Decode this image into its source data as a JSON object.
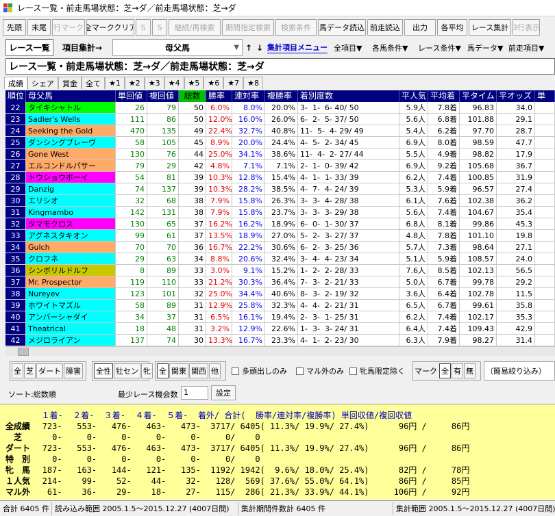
{
  "window": {
    "title": "レース一覧・前走馬場状態：芝→ダ／前走馬場状態：芝→ダ"
  },
  "toolbar": [
    {
      "label": "先頭",
      "w": 34,
      "enabled": true
    },
    {
      "label": "末尾",
      "w": 34,
      "enabled": true
    },
    {
      "label": "行マーク",
      "w": 48,
      "enabled": false
    },
    {
      "label": "全マーククリア",
      "w": 70,
      "enabled": true
    },
    {
      "label": "S",
      "w": 22,
      "enabled": false
    },
    {
      "label": "S",
      "w": 22,
      "enabled": false
    },
    {
      "label": "継続/再検索",
      "w": 76,
      "enabled": false
    },
    {
      "label": "期間指定検索",
      "w": 76,
      "enabled": false
    },
    {
      "label": "検索条件",
      "w": 60,
      "enabled": false
    },
    {
      "label": "馬データ読込",
      "w": 70,
      "enabled": true
    },
    {
      "label": "前走読込",
      "w": 52,
      "enabled": true
    },
    {
      "label": "出力",
      "w": 46,
      "enabled": true
    },
    {
      "label": "各平均",
      "w": 44,
      "enabled": true
    },
    {
      "label": "レース集計",
      "w": 62,
      "enabled": true
    },
    {
      "label": "3行表示",
      "w": 40,
      "enabled": false
    }
  ],
  "toolbar2": {
    "race_list": "レース一覧",
    "item_agg": "項目集計→",
    "combo_value": "母父馬",
    "up_arrow": "↑",
    "down_arrow": "↓",
    "agg_menu": "集計項目メニュー",
    "menus": [
      "全項目▼",
      "各馬条件▼",
      "レース条件▼",
      "馬データ▼",
      "前走項目▼"
    ]
  },
  "headline": "レース一覧・前走馬場状態：芝→ダ／前走馬場状態：芝→ダ",
  "tabs": [
    {
      "label": "成績",
      "active": true
    },
    {
      "label": "シェア",
      "active": false
    },
    {
      "label": "賞金",
      "active": false
    },
    {
      "label": "全て",
      "active": false
    },
    {
      "label": "★1",
      "active": false
    },
    {
      "label": "★2",
      "active": false
    },
    {
      "label": "★3",
      "active": false
    },
    {
      "label": "★4",
      "active": false
    },
    {
      "label": "★5",
      "active": false
    },
    {
      "label": "★6",
      "active": false
    },
    {
      "label": "★7",
      "active": false
    },
    {
      "label": "★8",
      "active": false
    }
  ],
  "colors": {
    "header_bg": "#000080",
    "total_header_bg": "#00c000",
    "rank_bg": "#000080",
    "green": "#00ff00",
    "cyan": "#00ffff",
    "orange": "#ffaa66",
    "magenta": "#ff00ff",
    "olive": "#c8c800",
    "white": "#ffffff",
    "summary_bg": "#ffff99"
  },
  "table": {
    "headers": [
      "順位",
      "母父馬",
      "単回値",
      "複回値",
      "総数",
      "勝率",
      "連対率",
      "複勝率",
      "着別度数",
      "平人気",
      "平均着",
      "平タイム",
      "平オッズ",
      "単"
    ],
    "rows": [
      {
        "rank": "22",
        "name": "タイキシャトル",
        "color": "green",
        "tan": "26",
        "fuku": "79",
        "total": "50",
        "win": "6.0%",
        "ren": "8.0%",
        "fuk": "20.0%",
        "dist": "3-  1-  6- 40/ 50",
        "ninki": "5.9人",
        "chaku": "7.8着",
        "time": "96.83",
        "odds": "34.0"
      },
      {
        "rank": "23",
        "name": "Sadler's Wells",
        "color": "cyan",
        "tan": "111",
        "fuku": "86",
        "total": "50",
        "win": "12.0%",
        "ren": "16.0%",
        "fuk": "26.0%",
        "dist": "6-  2-  5- 37/ 50",
        "ninki": "5.6人",
        "chaku": "6.8着",
        "time": "101.88",
        "odds": "29.1"
      },
      {
        "rank": "24",
        "name": "Seeking the Gold",
        "color": "orange",
        "tan": "470",
        "fuku": "135",
        "total": "49",
        "win": "22.4%",
        "ren": "32.7%",
        "fuk": "40.8%",
        "dist": "11-  5-  4- 29/ 49",
        "ninki": "5.4人",
        "chaku": "6.2着",
        "time": "97.70",
        "odds": "28.7"
      },
      {
        "rank": "25",
        "name": "ダンシングブレーヴ",
        "color": "cyan",
        "tan": "58",
        "fuku": "105",
        "total": "45",
        "win": "8.9%",
        "ren": "20.0%",
        "fuk": "24.4%",
        "dist": "4-  5-  2- 34/ 45",
        "ninki": "6.9人",
        "chaku": "8.0着",
        "time": "98.59",
        "odds": "47.7"
      },
      {
        "rank": "26",
        "name": "Gone West",
        "color": "orange",
        "tan": "130",
        "fuku": "76",
        "total": "44",
        "win": "25.0%",
        "ren": "34.1%",
        "fuk": "38.6%",
        "dist": "11-  4-  2- 27/ 44",
        "ninki": "5.5人",
        "chaku": "4.9着",
        "time": "98.82",
        "odds": "17.9"
      },
      {
        "rank": "27",
        "name": "エルコンドルパサー",
        "color": "orange",
        "tan": "79",
        "fuku": "29",
        "total": "42",
        "win": "4.8%",
        "ren": "7.1%",
        "fuk": "7.1%",
        "dist": "2-  1-  0- 39/ 42",
        "ninki": "6.9人",
        "chaku": "9.2着",
        "time": "105.68",
        "odds": "36.7"
      },
      {
        "rank": "28",
        "name": "トウショウボーイ",
        "color": "magenta",
        "tan": "54",
        "fuku": "81",
        "total": "39",
        "win": "10.3%",
        "ren": "12.8%",
        "fuk": "15.4%",
        "dist": "4-  1-  1- 33/ 39",
        "ninki": "6.2人",
        "chaku": "7.4着",
        "time": "100.85",
        "odds": "31.9"
      },
      {
        "rank": "29",
        "name": "Danzig",
        "color": "cyan",
        "tan": "74",
        "fuku": "137",
        "total": "39",
        "win": "10.3%",
        "ren": "28.2%",
        "fuk": "38.5%",
        "dist": "4-  7-  4- 24/ 39",
        "ninki": "5.3人",
        "chaku": "5.9着",
        "time": "96.57",
        "odds": "27.4"
      },
      {
        "rank": "30",
        "name": "エリシオ",
        "color": "cyan",
        "tan": "32",
        "fuku": "68",
        "total": "38",
        "win": "7.9%",
        "ren": "15.8%",
        "fuk": "26.3%",
        "dist": "3-  3-  4- 28/ 38",
        "ninki": "6.1人",
        "chaku": "7.6着",
        "time": "102.38",
        "odds": "36.2"
      },
      {
        "rank": "31",
        "name": "Kingmambo",
        "color": "cyan",
        "tan": "142",
        "fuku": "131",
        "total": "38",
        "win": "7.9%",
        "ren": "15.8%",
        "fuk": "23.7%",
        "dist": "3-  3-  3- 29/ 38",
        "ninki": "5.6人",
        "chaku": "7.4着",
        "time": "104.67",
        "odds": "35.4"
      },
      {
        "rank": "32",
        "name": "タマモクロス",
        "color": "magenta",
        "tan": "130",
        "fuku": "65",
        "total": "37",
        "win": "16.2%",
        "ren": "16.2%",
        "fuk": "18.9%",
        "dist": "6-  0-  1- 30/ 37",
        "ninki": "6.8人",
        "chaku": "8.1着",
        "time": "99.86",
        "odds": "45.3"
      },
      {
        "rank": "33",
        "name": "アグネスタキオン",
        "color": "cyan",
        "tan": "99",
        "fuku": "61",
        "total": "37",
        "win": "13.5%",
        "ren": "18.9%",
        "fuk": "27.0%",
        "dist": "5-  2-  3- 27/ 37",
        "ninki": "4.8人",
        "chaku": "7.8着",
        "time": "101.10",
        "odds": "19.8"
      },
      {
        "rank": "34",
        "name": "Gulch",
        "color": "orange",
        "tan": "70",
        "fuku": "70",
        "total": "36",
        "win": "16.7%",
        "ren": "22.2%",
        "fuk": "30.6%",
        "dist": "6-  2-  3- 25/ 36",
        "ninki": "5.7人",
        "chaku": "7.3着",
        "time": "98.64",
        "odds": "27.1"
      },
      {
        "rank": "35",
        "name": "クロフネ",
        "color": "cyan",
        "tan": "29",
        "fuku": "63",
        "total": "34",
        "win": "8.8%",
        "ren": "20.6%",
        "fuk": "32.4%",
        "dist": "3-  4-  4- 23/ 34",
        "ninki": "5.1人",
        "chaku": "5.9着",
        "time": "108.57",
        "odds": "24.0"
      },
      {
        "rank": "36",
        "name": "シンボリルドルフ",
        "color": "olive",
        "tan": "8",
        "fuku": "89",
        "total": "33",
        "win": "3.0%",
        "ren": "9.1%",
        "fuk": "15.2%",
        "dist": "1-  2-  2- 28/ 33",
        "ninki": "7.6人",
        "chaku": "8.5着",
        "time": "102.13",
        "odds": "56.5"
      },
      {
        "rank": "37",
        "name": "Mr. Prospector",
        "color": "orange",
        "tan": "119",
        "fuku": "110",
        "total": "33",
        "win": "21.2%",
        "ren": "30.3%",
        "fuk": "36.4%",
        "dist": "7-  3-  2- 21/ 33",
        "ninki": "5.0人",
        "chaku": "6.7着",
        "time": "99.78",
        "odds": "29.2"
      },
      {
        "rank": "38",
        "name": "Nureyev",
        "color": "cyan",
        "tan": "123",
        "fuku": "101",
        "total": "32",
        "win": "25.0%",
        "ren": "34.4%",
        "fuk": "40.6%",
        "dist": "8-  3-  2- 19/ 32",
        "ninki": "3.6人",
        "chaku": "6.4着",
        "time": "102.78",
        "odds": "11.5"
      },
      {
        "rank": "39",
        "name": "ホワイトマズル",
        "color": "cyan",
        "tan": "58",
        "fuku": "89",
        "total": "31",
        "win": "12.9%",
        "ren": "25.8%",
        "fuk": "32.3%",
        "dist": "4-  4-  2- 21/ 31",
        "ninki": "6.5人",
        "chaku": "6.7着",
        "time": "99.61",
        "odds": "35.8"
      },
      {
        "rank": "40",
        "name": "アンバーシャダイ",
        "color": "cyan",
        "tan": "34",
        "fuku": "37",
        "total": "31",
        "win": "6.5%",
        "ren": "16.1%",
        "fuk": "19.4%",
        "dist": "2-  3-  1- 25/ 31",
        "ninki": "6.2人",
        "chaku": "7.4着",
        "time": "102.17",
        "odds": "35.3"
      },
      {
        "rank": "41",
        "name": "Theatrical",
        "color": "cyan",
        "tan": "18",
        "fuku": "48",
        "total": "31",
        "win": "3.2%",
        "ren": "12.9%",
        "fuk": "22.6%",
        "dist": "1-  3-  3- 24/ 31",
        "ninki": "6.4人",
        "chaku": "7.4着",
        "time": "109.43",
        "odds": "42.9"
      },
      {
        "rank": "42",
        "name": "メジロライアン",
        "color": "cyan",
        "tan": "137",
        "fuku": "74",
        "total": "30",
        "win": "13.3%",
        "ren": "16.7%",
        "fuk": "23.3%",
        "dist": "4-  1-  2- 23/ 30",
        "ninki": "6.3人",
        "chaku": "7.9着",
        "time": "98.27",
        "odds": "31.4"
      }
    ]
  },
  "filters": {
    "surface": [
      "全",
      "芝",
      "ダート",
      "障害"
    ],
    "sex": [
      "全性",
      "牡セン",
      "牝"
    ],
    "region": [
      "全",
      "関東",
      "関西",
      "他"
    ],
    "checks": [
      "多頭出しのみ",
      "マル外のみ",
      "牝馬限定除く"
    ],
    "mark_label": "マーク",
    "mark_options": [
      "全",
      "有",
      "無"
    ],
    "simple_filter": "（簡易絞り込み）"
  },
  "sort": {
    "label": "ソート:総数順",
    "min_label": "最少レース機会数",
    "min_value": "1",
    "set_button": "設定"
  },
  "summary": {
    "header": "  １着-  ２着-  ３着-  ４着-  ５着-  着外/ 合計(  勝率/連対率/複勝率) 単回収値/複回収値",
    "rows": [
      {
        "label": "全成績",
        "text": "   723-   553-   476-   463-   473-  3717/ 6405( 11.3%/ 19.9%/ 27.4%)      96円 /     86円"
      },
      {
        "label": "　芝　",
        "text": "     0-     0-     0-     0-     0-     0/    0"
      },
      {
        "label": "ダート",
        "text": "   723-   553-   476-   463-   473-  3717/ 6405( 11.3%/ 19.9%/ 27.4%)      96円 /     86円"
      },
      {
        "label": "特　別",
        "text": "     0-     0-     0-     0-     0-     0/    0"
      },
      {
        "label": "牝　馬",
        "text": "   187-   163-   144-   121-   135-  1192/ 1942(  9.6%/ 18.0%/ 25.4%)      82円 /     78円"
      },
      {
        "label": "１人気",
        "text": "   214-    99-    52-    44-    32-   128/  569( 37.6%/ 55.0%/ 64.1%)      86円 /     85円"
      },
      {
        "label": "マル外",
        "text": "    61-    36-    29-    18-    27-   115/  286( 21.3%/ 33.9%/ 44.1%)     106円 /     92円"
      }
    ]
  },
  "status": [
    "合計 6405 件",
    "読み込み範囲 2005.1.5～2015.12.27 (4007日間)",
    "集計期間件数計 6405 件",
    "集計範囲 2005.1.5～2015.12.27 (4007日間)"
  ]
}
